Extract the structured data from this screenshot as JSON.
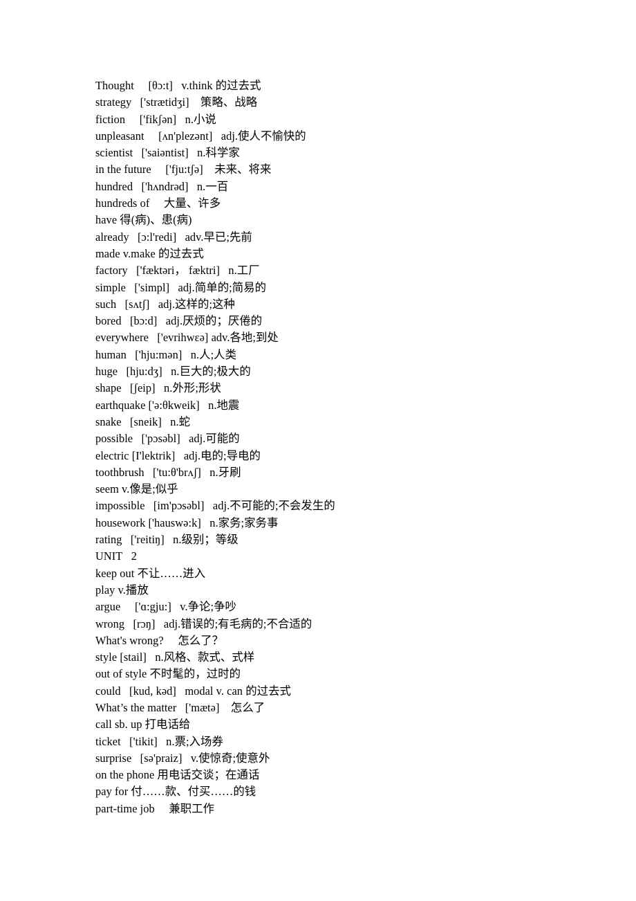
{
  "document": {
    "type": "vocabulary-glossary",
    "language_pair": "English-Chinese",
    "page_background": "#ffffff",
    "text_color": "#000000"
  },
  "entries": [
    {
      "line": "Thought  [θɔ:t]  v.think 的过去式"
    },
    {
      "line": "strategy  ['strætidʒi] 策略、战略"
    },
    {
      "line": "fiction  ['fikʃən]  n.小说"
    },
    {
      "line": "unpleasant  [ʌn'plezənt]  adj.使人不愉快的"
    },
    {
      "line": "scientist  ['saiəntist]  n.科学家"
    },
    {
      "line": "in the future  ['fju:tʃə] 未来、将来"
    },
    {
      "line": "hundred  ['hʌndrəd]  n.一百"
    },
    {
      "line": "hundreds of  大量、许多"
    },
    {
      "line": "have 得(病)、患(病)"
    },
    {
      "line": "already  [ɔ:l'redi]  adv.早已;先前"
    },
    {
      "line": "made v.make 的过去式"
    },
    {
      "line": "factory  ['fæktəri， fæktri]  n.工厂"
    },
    {
      "line": "simple  ['simpl]  adj.简单的;简易的"
    },
    {
      "line": "such  [sʌtʃ]  adj.这样的;这种"
    },
    {
      "line": "bored  [bɔ:d]  adj.厌烦的；厌倦的"
    },
    {
      "line": "everywhere  ['evrihwεə] adv.各地;到处"
    },
    {
      "line": "human  ['hju:mən]  n.人;人类"
    },
    {
      "line": "huge  [hju:dʒ]  n.巨大的;极大的"
    },
    {
      "line": "shape  [ʃeip]  n.外形;形状"
    },
    {
      "line": "earthquake ['ə:θkweik]  n.地震"
    },
    {
      "line": "snake  [sneik]  n.蛇"
    },
    {
      "line": "possible  ['pɔsəbl]  adj.可能的"
    },
    {
      "line": "electric [I'lektrik]  adj.电的;导电的"
    },
    {
      "line": "toothbrush  ['tu:θ'brʌʃ]  n.牙刷"
    },
    {
      "line": "seem v.像是;似乎"
    },
    {
      "line": "impossible  [im'pɔsəbl]  adj.不可能的;不会发生的"
    },
    {
      "line": "housework ['hauswə:k]  n.家务;家务事"
    },
    {
      "line": "rating  ['reitiŋ]  n.级别；等级"
    },
    {
      "line": "UNIT  2"
    },
    {
      "line": "keep out 不让……进入"
    },
    {
      "line": "play v.播放"
    },
    {
      "line": "argue  ['ɑ:gju:]  v.争论;争吵"
    },
    {
      "line": "wrong  [rɔŋ]  adj.错误的;有毛病的;不合适的"
    },
    {
      "line": "What's wrong?  怎么了？"
    },
    {
      "line": "style [stail]  n.风格、款式、式样"
    },
    {
      "line": "out of style 不时髦的，过时的"
    },
    {
      "line": "could  [kud, kəd]  modal v. can 的过去式"
    },
    {
      "line": "What’s the matter  ['mætə] 怎么了"
    },
    {
      "line": "call sb. up 打电话给"
    },
    {
      "line": "ticket  ['tikit]  n.票;入场券"
    },
    {
      "line": "surprise  [sə'praiz]  v.使惊奇;使意外"
    },
    {
      "line": "on the phone 用电话交谈；在通话"
    },
    {
      "line": "pay for 付……款、付买……的钱"
    },
    {
      "line": "part-time job  兼职工作"
    }
  ]
}
